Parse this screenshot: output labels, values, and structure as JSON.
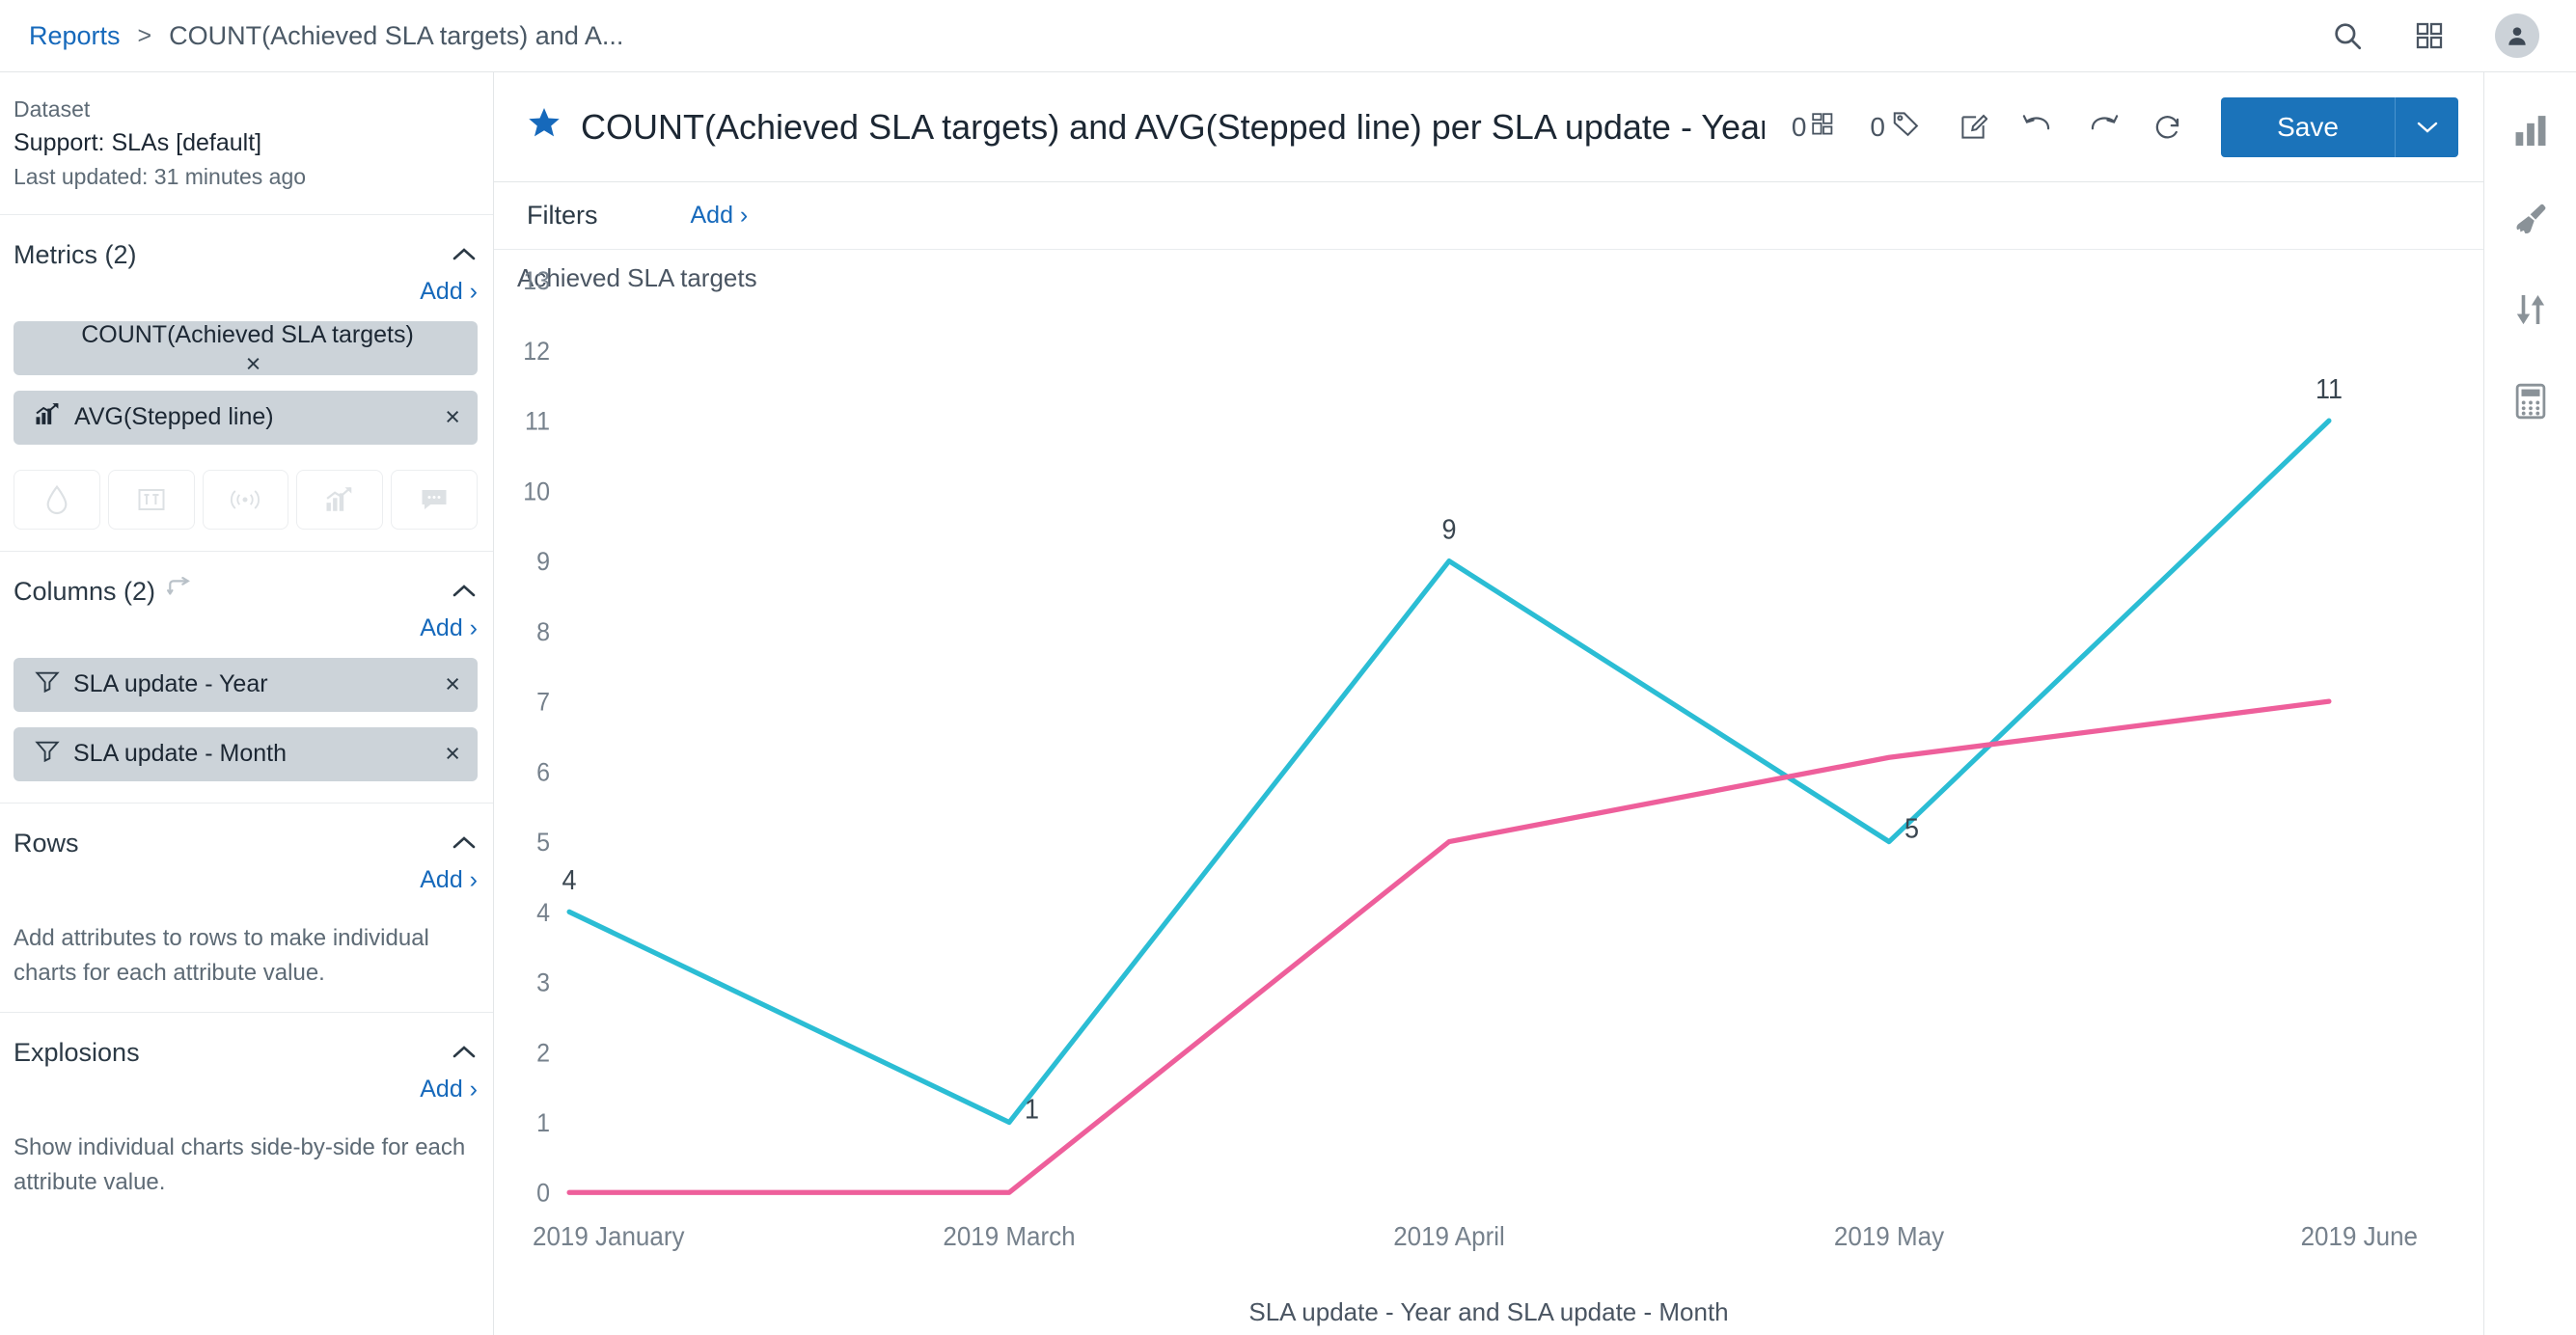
{
  "topbar": {
    "breadcrumb_root": "Reports",
    "breadcrumb_sep": ">",
    "breadcrumb_current": "COUNT(Achieved SLA targets) and A...",
    "search_icon": "search-icon",
    "apps_icon": "grid-apps-icon",
    "avatar_icon": "user-avatar-icon"
  },
  "dataset": {
    "label": "Dataset",
    "name": "Support: SLAs [default]",
    "updated": "Last updated: 31 minutes ago"
  },
  "metrics": {
    "title": "Metrics (2)",
    "add_label": "Add ›",
    "items": [
      {
        "label": "COUNT(Achieved SLA targets)",
        "icon": null,
        "remove": "×"
      },
      {
        "label": "AVG(Stepped line)",
        "icon": "trend-chart-icon",
        "remove": "×"
      }
    ],
    "type_icons": [
      "water-drop-icon",
      "text-format-icon",
      "pulse-signal-icon",
      "trend-chart-icon",
      "comment-icon"
    ]
  },
  "columns": {
    "title": "Columns (2)",
    "swap_icon": "swap-arrows-icon",
    "add_label": "Add ›",
    "items": [
      {
        "label": "SLA update - Year",
        "icon": "filter-funnel-icon",
        "remove": "×"
      },
      {
        "label": "SLA update - Month",
        "icon": "filter-funnel-icon",
        "remove": "×"
      }
    ]
  },
  "rows": {
    "title": "Rows",
    "add_label": "Add ›",
    "note": "Add attributes to rows to make individual charts for each attribute value."
  },
  "explosions": {
    "title": "Explosions",
    "add_label": "Add ›",
    "note": "Show individual charts side-by-side for each attribute value."
  },
  "report": {
    "favorite_icon": "star-filled-icon",
    "title": "COUNT(Achieved SLA targets) and AVG(Stepped line) per SLA update - Year and S",
    "counters": [
      {
        "value": "0",
        "icon": "dashboard-tiles-icon"
      },
      {
        "value": "0",
        "icon": "tag-icon"
      }
    ],
    "actions": [
      {
        "icon": "edit-pencil-icon"
      },
      {
        "icon": "undo-icon"
      },
      {
        "icon": "redo-icon"
      },
      {
        "icon": "refresh-icon"
      }
    ],
    "save_label": "Save",
    "save_caret_icon": "chevron-down-icon"
  },
  "filters": {
    "label": "Filters",
    "add_label": "Add ›"
  },
  "right_rail": [
    {
      "icon": "bar-chart-icon"
    },
    {
      "icon": "paint-brush-icon"
    },
    {
      "icon": "sort-arrows-icon"
    },
    {
      "icon": "calculator-icon"
    }
  ],
  "chart_data": {
    "type": "line",
    "title": "",
    "ylabel": "Achieved SLA targets",
    "xlabel": "SLA update - Year and SLA update - Month",
    "categories": [
      "2019 January",
      "2019 March",
      "2019 April",
      "2019 May",
      "2019 June"
    ],
    "ylim": [
      0,
      13
    ],
    "yticks": [
      0,
      1,
      2,
      3,
      4,
      5,
      6,
      7,
      8,
      9,
      10,
      11,
      12,
      13
    ],
    "grid": false,
    "legend": "none",
    "series": [
      {
        "name": "COUNT(Achieved SLA targets)",
        "color": "#2bbdd4",
        "values": [
          4,
          1,
          9,
          5,
          11
        ],
        "labels": [
          "4",
          "1",
          "9",
          "5",
          "11"
        ]
      },
      {
        "name": "AVG(Stepped line)",
        "color": "#ee5f9b",
        "values": [
          0,
          0,
          5,
          6.2,
          7
        ],
        "labels": [
          "",
          "",
          "",
          "",
          ""
        ]
      }
    ]
  }
}
